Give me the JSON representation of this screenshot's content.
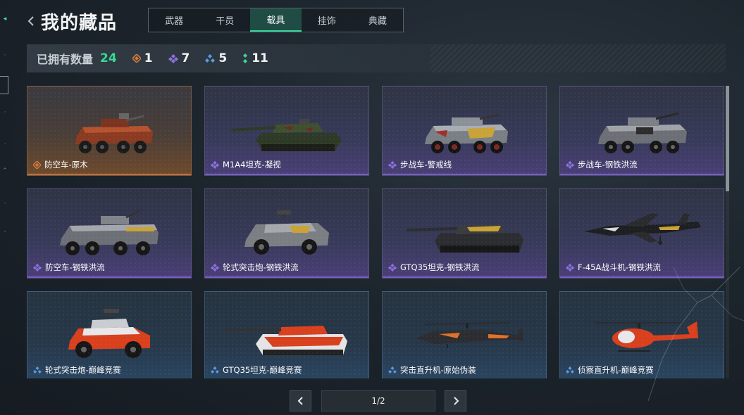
{
  "header": {
    "title": "我的藏品",
    "tabs": [
      {
        "label": "武器",
        "active": false
      },
      {
        "label": "干员",
        "active": false
      },
      {
        "label": "载具",
        "active": true
      },
      {
        "label": "挂饰",
        "active": false
      },
      {
        "label": "典藏",
        "active": false
      }
    ]
  },
  "summary": {
    "owned_label": "已拥有数量",
    "owned_total": "24",
    "rarities": [
      {
        "name": "orange",
        "icon": "orange-rarity-icon",
        "color": "#d07a3e",
        "count": "1"
      },
      {
        "name": "purple",
        "icon": "purple-rarity-icon",
        "color": "#8f6fe0",
        "count": "7"
      },
      {
        "name": "blue",
        "icon": "blue-rarity-icon",
        "color": "#5b9be0",
        "count": "5"
      },
      {
        "name": "green",
        "icon": "green-rarity-icon",
        "color": "#3fd69a",
        "count": "11"
      }
    ]
  },
  "items": [
    {
      "name": "防空车-原木",
      "rarity": "orange",
      "vehicle": "wheeled-aa-vehicle"
    },
    {
      "name": "M1A4坦克-凝视",
      "rarity": "purple",
      "vehicle": "tank"
    },
    {
      "name": "步战车-警戒线",
      "rarity": "purple",
      "vehicle": "wheeled-ifv"
    },
    {
      "name": "步战车-钢铁洪流",
      "rarity": "purple",
      "vehicle": "wheeled-ifv"
    },
    {
      "name": "防空车-钢铁洪流",
      "rarity": "purple",
      "vehicle": "wheeled-aa-vehicle"
    },
    {
      "name": "轮式突击炮-钢铁洪流",
      "rarity": "purple",
      "vehicle": "armored-car"
    },
    {
      "name": "GTQ35坦克-钢铁洪流",
      "rarity": "purple",
      "vehicle": "tank"
    },
    {
      "name": "F-45A战斗机-钢铁洪流",
      "rarity": "purple",
      "vehicle": "fighter-jet"
    },
    {
      "name": "轮式突击炮-巅峰竞赛",
      "rarity": "blue",
      "vehicle": "armored-car"
    },
    {
      "name": "GTQ35坦克-巅峰竞赛",
      "rarity": "blue",
      "vehicle": "tank"
    },
    {
      "name": "突击直升机-原始伪装",
      "rarity": "blue",
      "vehicle": "attack-helicopter"
    },
    {
      "name": "侦察直升机-巅峰竞赛",
      "rarity": "blue",
      "vehicle": "scout-helicopter"
    }
  ],
  "pagination": {
    "display": "1/2"
  },
  "colors": {
    "accent": "#36d49a",
    "active_tab_bg": "#1f4c44"
  }
}
